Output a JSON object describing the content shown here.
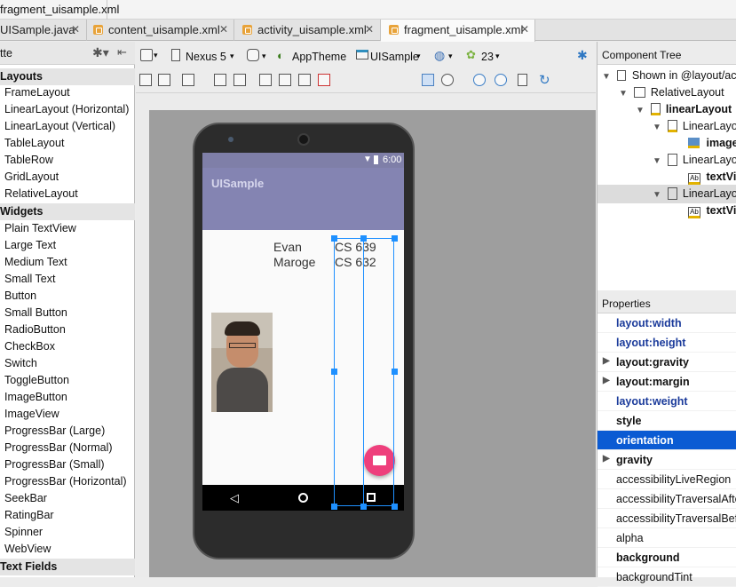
{
  "breadcrumb": "fragment_uisample.xml",
  "tabs": [
    {
      "label": "UISample.java"
    },
    {
      "label": "content_uisample.xml"
    },
    {
      "label": "activity_uisample.xml"
    },
    {
      "label": "fragment_uisample.xml"
    }
  ],
  "palette": {
    "title": "tte",
    "groups": [
      "Layouts",
      "Widgets",
      "Text Fields"
    ],
    "layouts": [
      "FrameLayout",
      "LinearLayout (Horizontal)",
      "LinearLayout (Vertical)",
      "TableLayout",
      "TableRow",
      "GridLayout",
      "RelativeLayout"
    ],
    "widgets": [
      "Plain TextView",
      "Large Text",
      "Medium Text",
      "Small Text",
      "Button",
      "Small Button",
      "RadioButton",
      "CheckBox",
      "Switch",
      "ToggleButton",
      "ImageButton",
      "ImageView",
      "ProgressBar (Large)",
      "ProgressBar (Normal)",
      "ProgressBar (Small)",
      "ProgressBar (Horizontal)",
      "SeekBar",
      "RatingBar",
      "Spinner",
      "WebView"
    ]
  },
  "toolbar": {
    "device": "Nexus 5",
    "theme": "AppTheme",
    "activity": "UISample",
    "api": "23"
  },
  "device": {
    "time": "6:00",
    "app_title": "UISample",
    "first_name": "Evan",
    "last_name": "Maroge",
    "course1": "CS 639",
    "course2": "CS 632"
  },
  "component_tree": {
    "title": "Component Tree",
    "items": [
      "Shown in @layout/ac",
      "RelativeLayout",
      "linearLayout",
      "LinearLayout",
      "image",
      "LinearLayout",
      "textVi",
      "LinearLayout",
      "textVi"
    ]
  },
  "properties": {
    "title": "Properties",
    "items": [
      "layout:width",
      "layout:height",
      "layout:gravity",
      "layout:margin",
      "layout:weight",
      "style",
      "orientation",
      "gravity",
      "accessibilityLiveRegion",
      "accessibilityTraversalAfter",
      "accessibilityTraversalBefore",
      "alpha",
      "background",
      "backgroundTint"
    ]
  },
  "colors": {
    "accent": "#ee3f7c",
    "primary": "#8484b2",
    "selection": "#0b5bd3"
  }
}
